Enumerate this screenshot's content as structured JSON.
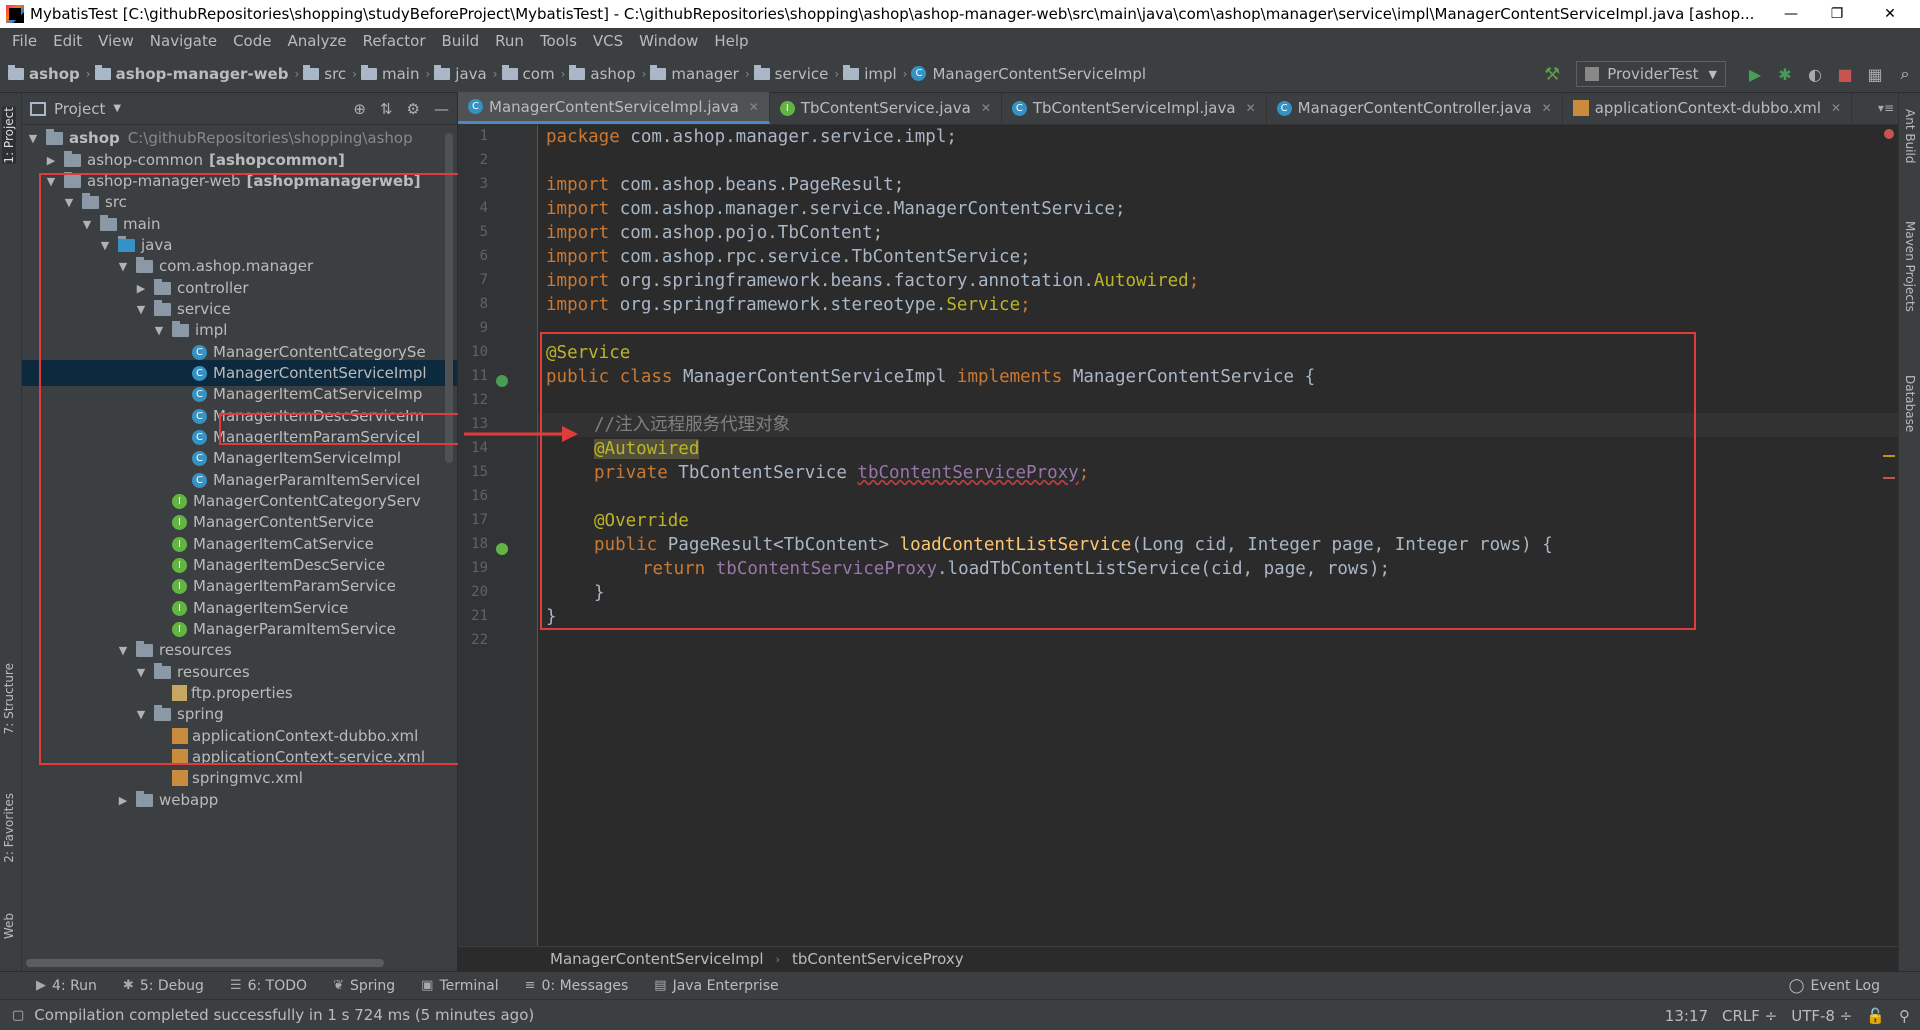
{
  "title_bar": {
    "title": "MybatisTest [C:\\githubRepositories\\shopping\\studyBeforeProject\\MybatisTest] - C:\\githubRepositories\\shopping\\ashop\\ashop-manager-web\\src\\main\\java\\com\\ashop\\manager\\service\\impl\\ManagerContentServiceImpl.java [ashop...",
    "minimize": "—",
    "restore": "❐",
    "close": "✕"
  },
  "menu": [
    "File",
    "Edit",
    "View",
    "Navigate",
    "Code",
    "Analyze",
    "Refactor",
    "Build",
    "Run",
    "Tools",
    "VCS",
    "Window",
    "Help"
  ],
  "nav": {
    "crumbs": [
      "ashop",
      "ashop-manager-web",
      "src",
      "main",
      "java",
      "com",
      "ashop",
      "manager",
      "service",
      "impl",
      "ManagerContentServiceImpl"
    ],
    "run_config": "ProviderTest"
  },
  "left_tabs": [
    "1: Project",
    "7: Structure",
    "2: Favorites",
    "Web"
  ],
  "right_tabs": [
    "Ant Build",
    "Maven Projects",
    "Database"
  ],
  "project_panel": {
    "title": "Project",
    "tree": [
      {
        "label": "ashop",
        "extra": "C:\\githubRepositories\\shopping\\ashop"
      },
      {
        "label": "ashop-common",
        "extra": "[ashopcommon]"
      },
      {
        "label": "ashop-manager-web",
        "extra": "[ashopmanagerweb]"
      },
      {
        "label": "src"
      },
      {
        "label": "main"
      },
      {
        "label": "java"
      },
      {
        "label": "com.ashop.manager"
      },
      {
        "label": "controller"
      },
      {
        "label": "service"
      },
      {
        "label": "impl"
      },
      {
        "label": "ManagerContentCategorySe"
      },
      {
        "label": "ManagerContentServiceImpl"
      },
      {
        "label": "ManagerItemCatServiceImp"
      },
      {
        "label": "ManagerItemDescServiceIm"
      },
      {
        "label": "ManagerItemParamServiceI"
      },
      {
        "label": "ManagerItemServiceImpl"
      },
      {
        "label": "ManagerParamItemServiceI"
      },
      {
        "label": "ManagerContentCategoryServ"
      },
      {
        "label": "ManagerContentService"
      },
      {
        "label": "ManagerItemCatService"
      },
      {
        "label": "ManagerItemDescService"
      },
      {
        "label": "ManagerItemParamService"
      },
      {
        "label": "ManagerItemService"
      },
      {
        "label": "ManagerParamItemService"
      },
      {
        "label": "resources"
      },
      {
        "label": "resources"
      },
      {
        "label": "ftp.properties"
      },
      {
        "label": "spring"
      },
      {
        "label": "applicationContext-dubbo.xml"
      },
      {
        "label": "applicationContext-service.xml"
      },
      {
        "label": "springmvc.xml"
      },
      {
        "label": "webapp"
      }
    ]
  },
  "editor_tabs": [
    {
      "label": "ManagerContentServiceImpl.java",
      "active": true
    },
    {
      "label": "TbContentService.java"
    },
    {
      "label": "TbContentServiceImpl.java"
    },
    {
      "label": "ManagerContentController.java"
    },
    {
      "label": "applicationContext-dubbo.xml"
    }
  ],
  "code": {
    "line_numbers": [
      "1",
      "2",
      "3",
      "4",
      "5",
      "6",
      "7",
      "8",
      "9",
      "10",
      "11",
      "12",
      "13",
      "14",
      "15",
      "16",
      "17",
      "18",
      "19",
      "20",
      "21",
      "22"
    ],
    "l1_kw": "package",
    "l1_rest": " com.ashop.manager.service.impl;",
    "l3_kw": "import",
    "l3_rest": " com.ashop.beans.PageResult;",
    "l4_kw": "import",
    "l4_rest": " com.ashop.manager.service.ManagerContentService;",
    "l5_kw": "import",
    "l5_rest": " com.ashop.pojo.TbContent;",
    "l6_kw": "import",
    "l6_rest": " com.ashop.rpc.service.TbContentService;",
    "l7_kw": "import",
    "l7_rest": " org.springframework.beans.factory.annotation.",
    "l7_ann": "Autowired",
    "l7_end": ";",
    "l8_kw": "import",
    "l8_rest": " org.springframework.stereotype.",
    "l8_ann": "Service",
    "l8_end": ";",
    "l10": "@Service",
    "l11_kw1": "public class",
    "l11_name": " ManagerContentServiceImpl ",
    "l11_kw2": "implements",
    "l11_rest": " ManagerContentService {",
    "l13": "//注入远程服务代理对象",
    "l14": "@Autowired",
    "l15_kw": "private",
    "l15_type": " TbContentService ",
    "l15_field": "tbContentServiceProxy",
    "l15_end": ";",
    "l17": "@Override",
    "l18_kw": "public",
    "l18_type": " PageResult<TbContent> ",
    "l18_fn": "loadContentListService",
    "l18_params": "(Long cid, Integer page, Integer rows) {",
    "l19_kw": "return",
    "l19_field": " tbContentServiceProxy",
    "l19_rest": ".loadTbContentListService(cid, page, rows);",
    "l20": "}",
    "l21": "}"
  },
  "editor_crumbs": [
    "ManagerContentServiceImpl",
    "tbContentServiceProxy"
  ],
  "bottom_tools": [
    {
      "label": "4: Run"
    },
    {
      "label": "5: Debug"
    },
    {
      "label": "6: TODO"
    },
    {
      "label": "Spring"
    },
    {
      "label": "Terminal"
    },
    {
      "label": "0: Messages"
    },
    {
      "label": "Java Enterprise"
    }
  ],
  "event_log": "Event Log",
  "status": {
    "message": "Compilation completed successfully in 1 s 724 ms (5 minutes ago)",
    "position": "13:17",
    "line_sep": "CRLF ÷",
    "encoding": "UTF-8 ÷"
  },
  "colors": {
    "annotation_red": "#e03c3c",
    "selection": "#0d293e",
    "keyword": "#cc7832"
  }
}
